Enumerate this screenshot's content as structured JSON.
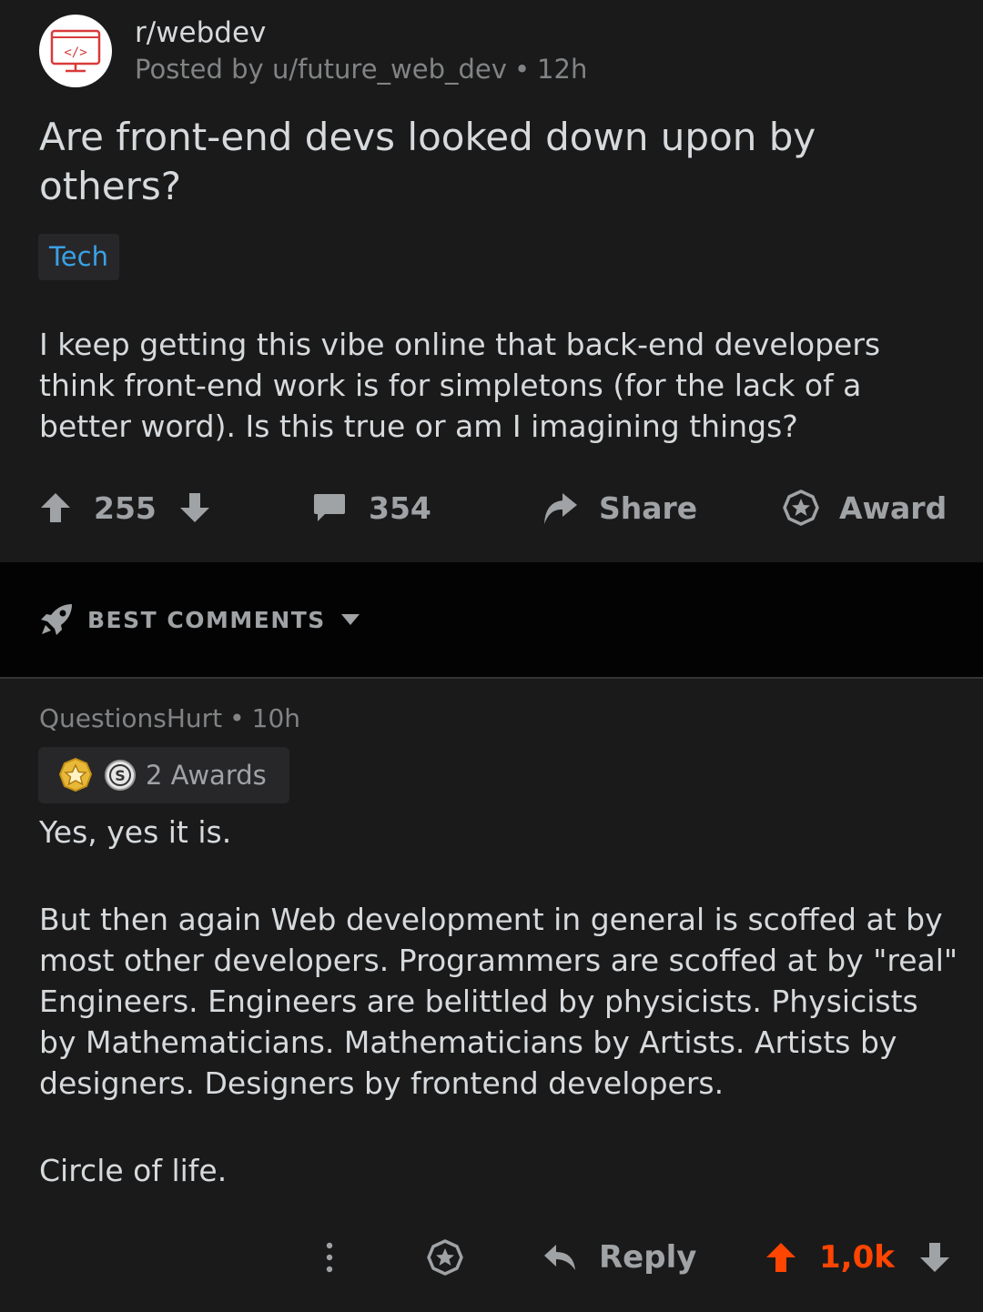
{
  "post": {
    "subreddit": "r/webdev",
    "posted_by_prefix": "Posted by",
    "author": "u/future_web_dev",
    "age": "12h",
    "title": "Are front-end devs looked down upon by others?",
    "flair": "Tech",
    "body": "I keep getting this vibe online that back-end developers think front-end work is for simpletons (for the lack of a better word). Is this true or am I imagining things?",
    "upvotes": "255",
    "comments": "354",
    "share_label": "Share",
    "award_label": "Award"
  },
  "sort": {
    "label": "BEST COMMENTS"
  },
  "comment": {
    "author": "QuestionsHurt",
    "age": "10h",
    "awards_text": "2 Awards",
    "paragraphs": [
      "Yes, yes it is.",
      "But then again Web development in general is scoffed at by most other developers. Programmers are scoffed at by \"real\" Engineers. Engineers are belittled by physicists. Physicists by Mathematicians. Mathematicians by Artists. Artists by designers. Designers by frontend developers.",
      "Circle of life."
    ],
    "reply_label": "Reply",
    "score": "1,0k"
  },
  "colors": {
    "background": "#1a1a1b",
    "band": "#030303",
    "upvote_active": "#ff4500",
    "flair_text": "#3aa1e6",
    "subreddit_icon": "#d93a3a"
  },
  "icons": {
    "subreddit": "code-monitor-icon",
    "upvote": "arrow-up-icon",
    "downvote": "arrow-down-icon",
    "comments": "speech-bubble-icon",
    "share": "share-arrow-icon",
    "award": "star-badge-icon",
    "sort": "rocket-icon",
    "more": "vertical-dots-icon",
    "reply": "reply-arrow-icon"
  }
}
